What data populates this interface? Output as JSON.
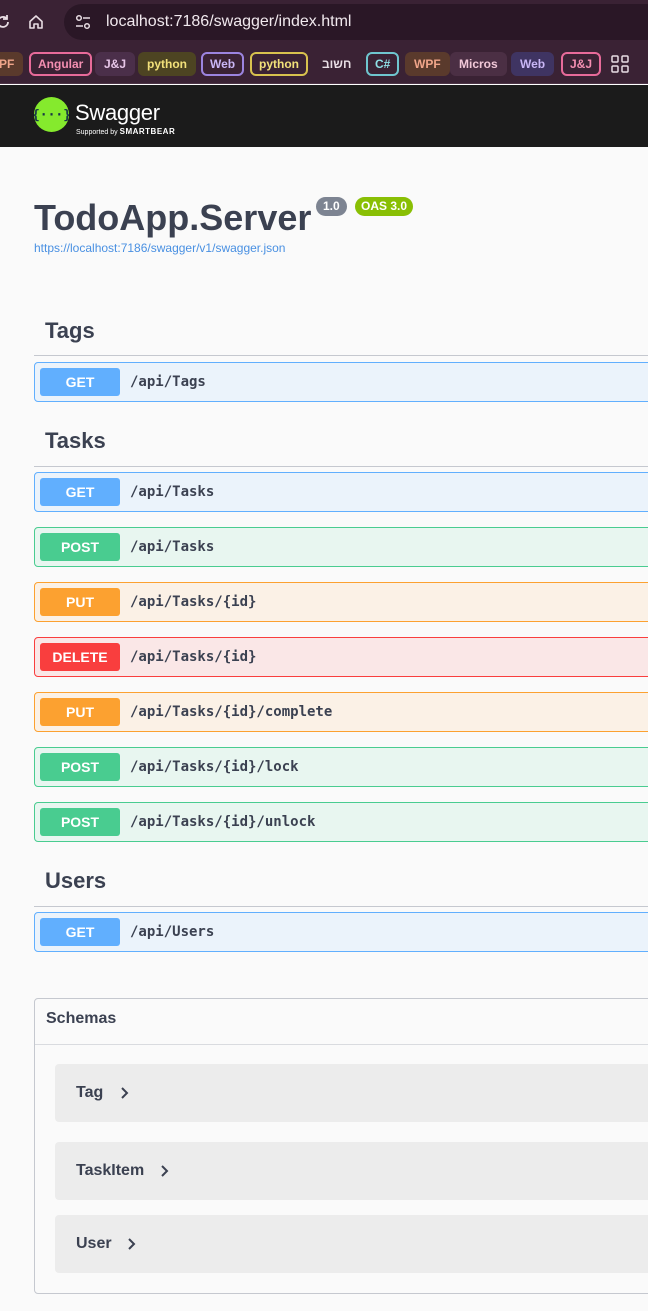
{
  "browser": {
    "url": "localhost:7186/swagger/index.html",
    "bookmarks": [
      {
        "label": "PF",
        "color": "#f0a58a",
        "bg": "#5a3a2c",
        "border": "transparent"
      },
      {
        "label": "Angular",
        "color": "#f48fb1",
        "bg": "transparent",
        "border": "#e86b9a"
      },
      {
        "label": "J&J",
        "color": "#e7c6e8",
        "bg": "#4b2f4a",
        "border": "transparent"
      },
      {
        "label": "python",
        "color": "#f2e07a",
        "bg": "#4d4422",
        "border": "transparent"
      },
      {
        "label": "Web",
        "color": "#c9b6f5",
        "bg": "transparent",
        "border": "#9c84e0"
      },
      {
        "label": "python",
        "color": "#f2e07a",
        "bg": "transparent",
        "border": "#d8c24e"
      },
      {
        "label": "חשוב",
        "color": "#eadfe6",
        "bg": "transparent",
        "border": "transparent"
      },
      {
        "label": "C#",
        "color": "#8fe0e6",
        "bg": "transparent",
        "border": "#6fc6cf"
      },
      {
        "label": "WPF",
        "color": "#f0a58a",
        "bg": "#5a3a2c",
        "border": "transparent"
      },
      {
        "label": "Micros",
        "color": "#f1c8d8",
        "bg": "#4b2f44",
        "border": "transparent"
      },
      {
        "label": "Web",
        "color": "#c9b6f5",
        "bg": "#3f3462",
        "border": "transparent"
      },
      {
        "label": "J&J",
        "color": "#f48fb1",
        "bg": "transparent",
        "border": "#e86b9a"
      }
    ]
  },
  "swagger": {
    "logo_text": "Swagger",
    "logo_sub_prefix": "Supported by",
    "logo_sub_brand": "SMARTBEAR",
    "title": "TodoApp.Server",
    "version": "1.0",
    "oas": "OAS 3.0",
    "spec_url": "https://localhost:7186/swagger/v1/swagger.json"
  },
  "sections": [
    {
      "name": "Tags",
      "ops": [
        {
          "method": "GET",
          "path": "/api/Tags"
        }
      ]
    },
    {
      "name": "Tasks",
      "ops": [
        {
          "method": "GET",
          "path": "/api/Tasks"
        },
        {
          "method": "POST",
          "path": "/api/Tasks"
        },
        {
          "method": "PUT",
          "path": "/api/Tasks/{id}"
        },
        {
          "method": "DELETE",
          "path": "/api/Tasks/{id}"
        },
        {
          "method": "PUT",
          "path": "/api/Tasks/{id}/complete"
        },
        {
          "method": "POST",
          "path": "/api/Tasks/{id}/lock"
        },
        {
          "method": "POST",
          "path": "/api/Tasks/{id}/unlock"
        }
      ]
    },
    {
      "name": "Users",
      "ops": [
        {
          "method": "GET",
          "path": "/api/Users"
        }
      ]
    }
  ],
  "schemas": {
    "title": "Schemas",
    "models": [
      "Tag",
      "TaskItem",
      "User"
    ]
  }
}
